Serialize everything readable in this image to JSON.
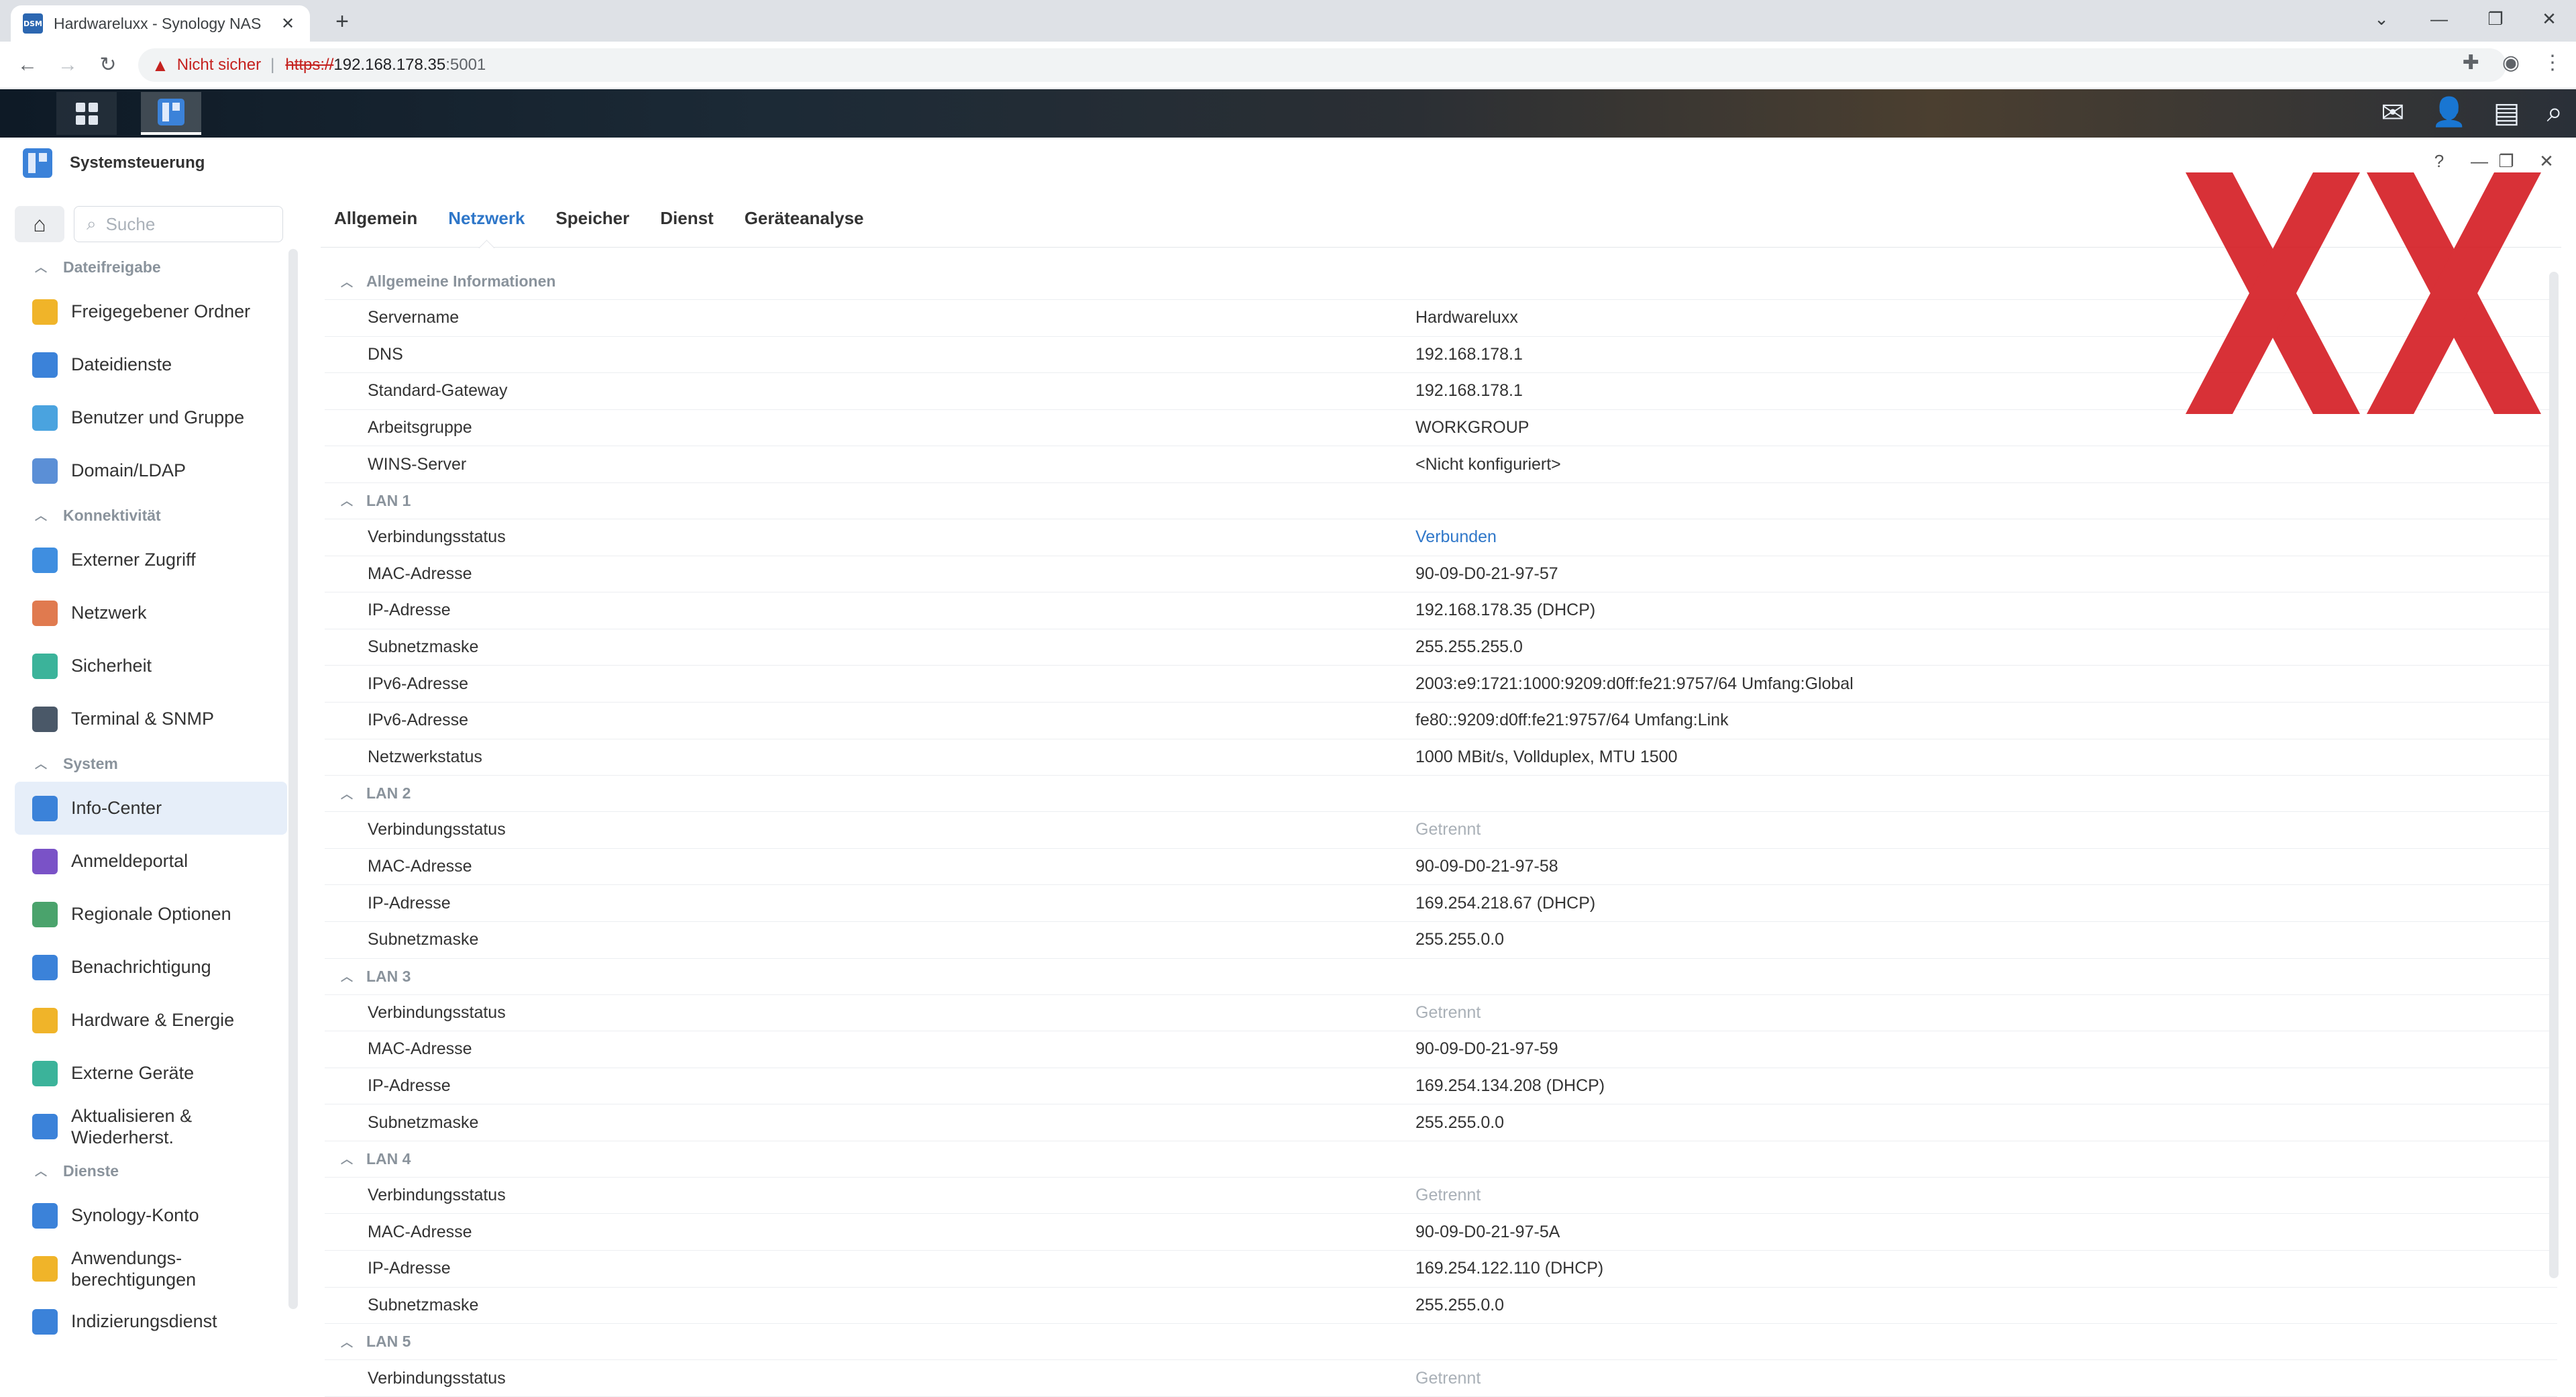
{
  "browser": {
    "tab_title": "Hardwareluxx - Synology NAS",
    "favicon_text": "DSM",
    "not_secure": "Nicht sicher",
    "url_scheme": "https://",
    "url_host": "192.168.178.35",
    "url_port": ":5001"
  },
  "window": {
    "title": "Systemsteuerung"
  },
  "sidebar": {
    "search_placeholder": "Suche",
    "sections": [
      {
        "label": "Dateifreigabe",
        "items": [
          {
            "label": "Freigegebener Ordner",
            "color": "#f0b429"
          },
          {
            "label": "Dateidienste",
            "color": "#3b82d9"
          },
          {
            "label": "Benutzer und Gruppe",
            "color": "#4aa3df"
          },
          {
            "label": "Domain/LDAP",
            "color": "#5b8fd6"
          }
        ]
      },
      {
        "label": "Konnektivität",
        "items": [
          {
            "label": "Externer Zugriff",
            "color": "#3f8ee0"
          },
          {
            "label": "Netzwerk",
            "color": "#e07a4f"
          },
          {
            "label": "Sicherheit",
            "color": "#3bb39a"
          },
          {
            "label": "Terminal & SNMP",
            "color": "#4a5868"
          }
        ]
      },
      {
        "label": "System",
        "items": [
          {
            "label": "Info-Center",
            "color": "#3b82d9",
            "active": true
          },
          {
            "label": "Anmeldeportal",
            "color": "#7a52c7"
          },
          {
            "label": "Regionale Optionen",
            "color": "#4aa36c"
          },
          {
            "label": "Benachrichtigung",
            "color": "#3b82d9"
          },
          {
            "label": "Hardware & Energie",
            "color": "#f0b429"
          },
          {
            "label": "Externe Geräte",
            "color": "#3bb39a"
          },
          {
            "label": "Aktualisieren & Wiederherst.",
            "color": "#3b82d9"
          }
        ]
      },
      {
        "label": "Dienste",
        "items": [
          {
            "label": "Synology-Konto",
            "color": "#3b82d9"
          },
          {
            "label": "Anwendungs-berechtigungen",
            "color": "#f0b429"
          },
          {
            "label": "Indizierungsdienst",
            "color": "#3b82d9"
          }
        ]
      }
    ]
  },
  "tabs": [
    "Allgemein",
    "Netzwerk",
    "Speicher",
    "Dienst",
    "Geräteanalyse"
  ],
  "active_tab": "Netzwerk",
  "groups": [
    {
      "title": "Allgemeine Informationen",
      "rows": [
        {
          "k": "Servername",
          "v": "Hardwareluxx"
        },
        {
          "k": "DNS",
          "v": "192.168.178.1"
        },
        {
          "k": "Standard-Gateway",
          "v": "192.168.178.1"
        },
        {
          "k": "Arbeitsgruppe",
          "v": "WORKGROUP"
        },
        {
          "k": "WINS-Server",
          "v": "<Nicht konfiguriert>"
        }
      ]
    },
    {
      "title": "LAN 1",
      "rows": [
        {
          "k": "Verbindungsstatus",
          "v": "Verbunden",
          "style": "link"
        },
        {
          "k": "MAC-Adresse",
          "v": "90-09-D0-21-97-57"
        },
        {
          "k": "IP-Adresse",
          "v": "192.168.178.35 (DHCP)"
        },
        {
          "k": "Subnetzmaske",
          "v": "255.255.255.0"
        },
        {
          "k": "IPv6-Adresse",
          "v": "2003:e9:1721:1000:9209:d0ff:fe21:9757/64 Umfang:Global"
        },
        {
          "k": "IPv6-Adresse",
          "v": "fe80::9209:d0ff:fe21:9757/64 Umfang:Link"
        },
        {
          "k": "Netzwerkstatus",
          "v": "1000 MBit/s, Vollduplex, MTU 1500"
        }
      ]
    },
    {
      "title": "LAN 2",
      "rows": [
        {
          "k": "Verbindungsstatus",
          "v": "Getrennt",
          "style": "muted"
        },
        {
          "k": "MAC-Adresse",
          "v": "90-09-D0-21-97-58"
        },
        {
          "k": "IP-Adresse",
          "v": "169.254.218.67 (DHCP)"
        },
        {
          "k": "Subnetzmaske",
          "v": "255.255.0.0"
        }
      ]
    },
    {
      "title": "LAN 3",
      "rows": [
        {
          "k": "Verbindungsstatus",
          "v": "Getrennt",
          "style": "muted"
        },
        {
          "k": "MAC-Adresse",
          "v": "90-09-D0-21-97-59"
        },
        {
          "k": "IP-Adresse",
          "v": "169.254.134.208 (DHCP)"
        },
        {
          "k": "Subnetzmaske",
          "v": "255.255.0.0"
        }
      ]
    },
    {
      "title": "LAN 4",
      "rows": [
        {
          "k": "Verbindungsstatus",
          "v": "Getrennt",
          "style": "muted"
        },
        {
          "k": "MAC-Adresse",
          "v": "90-09-D0-21-97-5A"
        },
        {
          "k": "IP-Adresse",
          "v": "169.254.122.110 (DHCP)"
        },
        {
          "k": "Subnetzmaske",
          "v": "255.255.0.0"
        }
      ]
    },
    {
      "title": "LAN 5",
      "rows": [
        {
          "k": "Verbindungsstatus",
          "v": "Getrennt",
          "style": "muted"
        }
      ]
    }
  ]
}
